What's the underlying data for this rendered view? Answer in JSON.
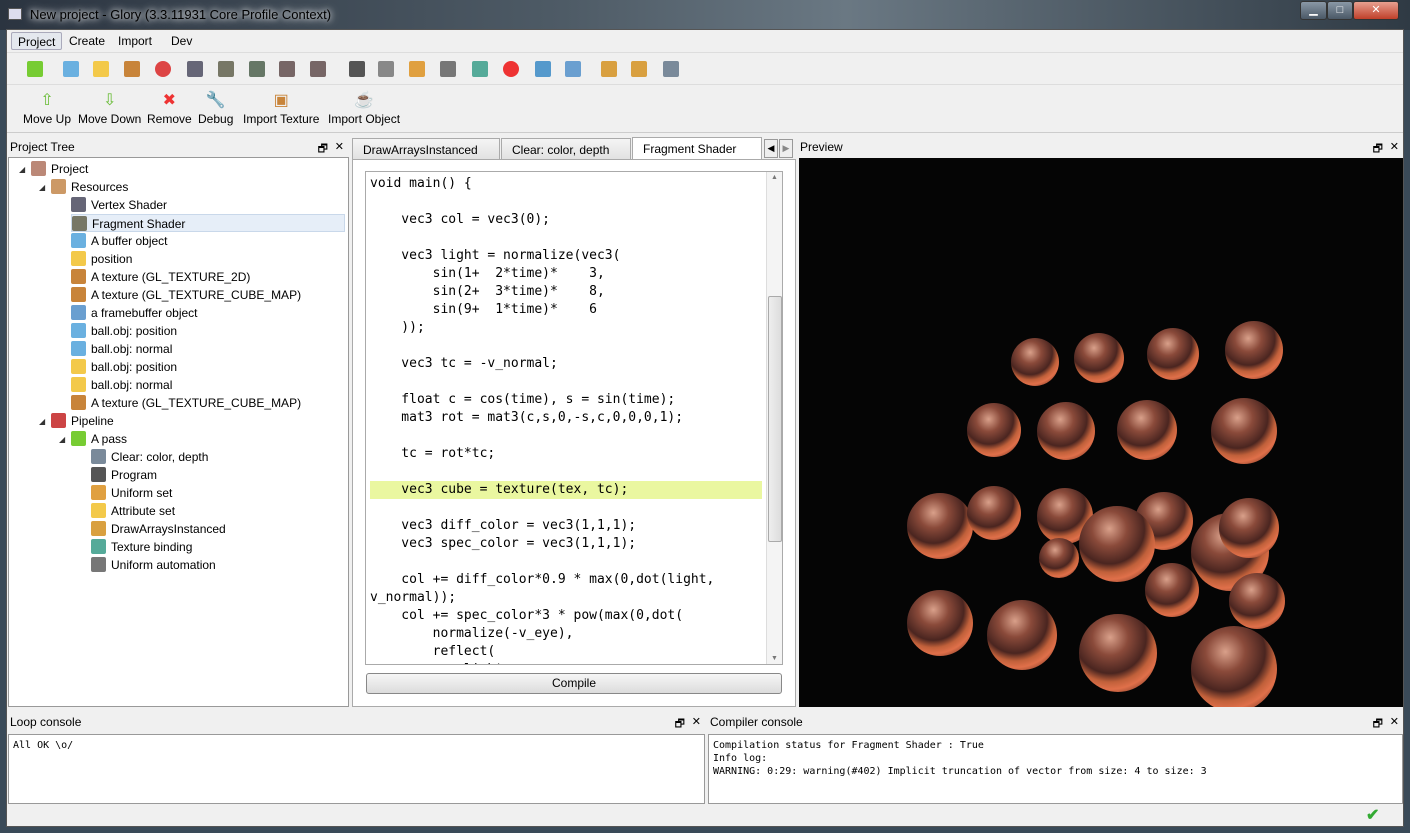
{
  "window": {
    "title": "New project - Glory (3.3.11931 Core Profile Context)",
    "minimize": "▁",
    "maximize": "□",
    "close": "✕"
  },
  "menu": [
    "Project",
    "Create",
    "Import",
    "Dev"
  ],
  "toolbar_icons": [
    "arrow-right",
    "database",
    "puzzle",
    "texture",
    "rgb",
    "vertex-shader",
    "fragment-shader",
    "geometry-shader",
    "tess-control-shader",
    "tess-eval-shader",
    "program",
    "attribute",
    "ruler",
    "joystick",
    "texture-binding",
    "stop",
    "framebuffer",
    "layers",
    "brush",
    "brush-2",
    "paint-bucket"
  ],
  "actions": [
    {
      "label": "Move Up",
      "icon": "⇧"
    },
    {
      "label": "Move Down",
      "icon": "⇩"
    },
    {
      "label": "Remove",
      "icon": "✖"
    },
    {
      "label": "Debug",
      "icon": "🔧"
    },
    {
      "label": "Import Texture",
      "icon": "▣"
    },
    {
      "label": "Import Object",
      "icon": "☕"
    }
  ],
  "project_tree": {
    "title": "Project Tree",
    "items": [
      {
        "label": "Project",
        "level": 0,
        "icon": "project",
        "expanded": true
      },
      {
        "label": "Resources",
        "level": 1,
        "icon": "box",
        "expanded": true
      },
      {
        "label": "Vertex Shader",
        "level": 2,
        "icon": "vertex-shader"
      },
      {
        "label": "Fragment Shader",
        "level": 2,
        "icon": "fragment-shader",
        "selected": true
      },
      {
        "label": "A buffer object",
        "level": 2,
        "icon": "database"
      },
      {
        "label": "position",
        "level": 2,
        "icon": "puzzle"
      },
      {
        "label": "A texture (GL_TEXTURE_2D)",
        "level": 2,
        "icon": "texture"
      },
      {
        "label": "A texture (GL_TEXTURE_CUBE_MAP)",
        "level": 2,
        "icon": "texture"
      },
      {
        "label": "a framebuffer object",
        "level": 2,
        "icon": "layers"
      },
      {
        "label": "ball.obj: position",
        "level": 2,
        "icon": "database"
      },
      {
        "label": "ball.obj: normal",
        "level": 2,
        "icon": "database"
      },
      {
        "label": "ball.obj: position",
        "level": 2,
        "icon": "puzzle"
      },
      {
        "label": "ball.obj: normal",
        "level": 2,
        "icon": "puzzle"
      },
      {
        "label": "A texture (GL_TEXTURE_CUBE_MAP)",
        "level": 2,
        "icon": "texture"
      },
      {
        "label": "Pipeline",
        "level": 1,
        "icon": "pipeline",
        "expanded": true
      },
      {
        "label": "A pass",
        "level": 2,
        "icon": "arrow-right",
        "expanded": true
      },
      {
        "label": "Clear: color, depth",
        "level": 3,
        "icon": "paint-bucket"
      },
      {
        "label": "Program",
        "level": 3,
        "icon": "program"
      },
      {
        "label": "Uniform set",
        "level": 3,
        "icon": "ruler"
      },
      {
        "label": "Attribute set",
        "level": 3,
        "icon": "puzzle"
      },
      {
        "label": "DrawArraysInstanced",
        "level": 3,
        "icon": "brush"
      },
      {
        "label": "Texture binding",
        "level": 3,
        "icon": "texture-binding"
      },
      {
        "label": "Uniform automation",
        "level": 3,
        "icon": "joystick"
      }
    ]
  },
  "tabs": [
    {
      "label": "DrawArraysInstanced"
    },
    {
      "label": "Clear: color, depth"
    },
    {
      "label": "Fragment Shader",
      "active": true
    }
  ],
  "editor": {
    "highlighted_line": 17,
    "lines": [
      "void main() {",
      "",
      "    vec3 col = vec3(0);",
      "",
      "    vec3 light = normalize(vec3(",
      "        sin(1+  2*time)*    3,",
      "        sin(2+  3*time)*    8,",
      "        sin(9+  1*time)*    6",
      "    ));",
      "",
      "    vec3 tc = -v_normal;",
      "",
      "    float c = cos(time), s = sin(time);",
      "    mat3 rot = mat3(c,s,0,-s,c,0,0,0,1);",
      "",
      "    tc = rot*tc;",
      "",
      "    vec3 cube = texture(tex, tc);",
      "",
      "    vec3 diff_color = vec3(1,1,1);",
      "    vec3 spec_color = vec3(1,1,1);",
      "",
      "    col += diff_color*0.9 * max(0,dot(light,",
      "v_normal));",
      "    col += spec_color*3 * pow(max(0,dot(",
      "        normalize(-v_eye),",
      "        reflect(",
      "            light,"
    ]
  },
  "compile_label": "Compile",
  "preview": {
    "title": "Preview"
  },
  "loop_console": {
    "title": "Loop console",
    "text": "All OK \\o/"
  },
  "compiler_console": {
    "title": "Compiler console",
    "text": "Compilation status for Fragment Shader : True\nInfo log:\nWARNING: 0:29: warning(#402) Implicit truncation of vector from size: 4 to size: 3"
  },
  "dock_controls": {
    "float": "🗗",
    "close": "✕"
  },
  "status": {
    "icon": "✔"
  }
}
